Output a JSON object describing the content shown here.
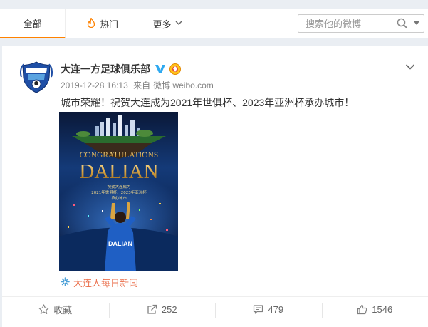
{
  "tabs": {
    "all_label": "全部",
    "hot_label": "热门",
    "more_label": "更多"
  },
  "search": {
    "placeholder": "搜索他的微博"
  },
  "post": {
    "author": "大连一方足球俱乐部",
    "timestamp": "2019-12-28 16:13",
    "source_prefix": "来自",
    "source": "微博 weibo.com",
    "text": "城市荣耀！祝贺大连成为2021年世俱杯、2023年亚洲杯承办城市！",
    "image": {
      "headline_top": "CONGRATULATIONS",
      "headline_main": "DALIAN",
      "caption_line1": "祝贺大连成为",
      "caption_line2": "2021年世俱杯、2023年亚洲杯",
      "caption_line3": "承办城市",
      "shirt_text": "DALIAN"
    },
    "location": "大连人每日新闻"
  },
  "actions": {
    "favorite_label": "收藏",
    "repost_count": "252",
    "comment_count": "479",
    "like_count": "1546"
  },
  "colors": {
    "accent": "#ff8200",
    "verified": "#2fa9f0",
    "link": "#eb7350"
  }
}
